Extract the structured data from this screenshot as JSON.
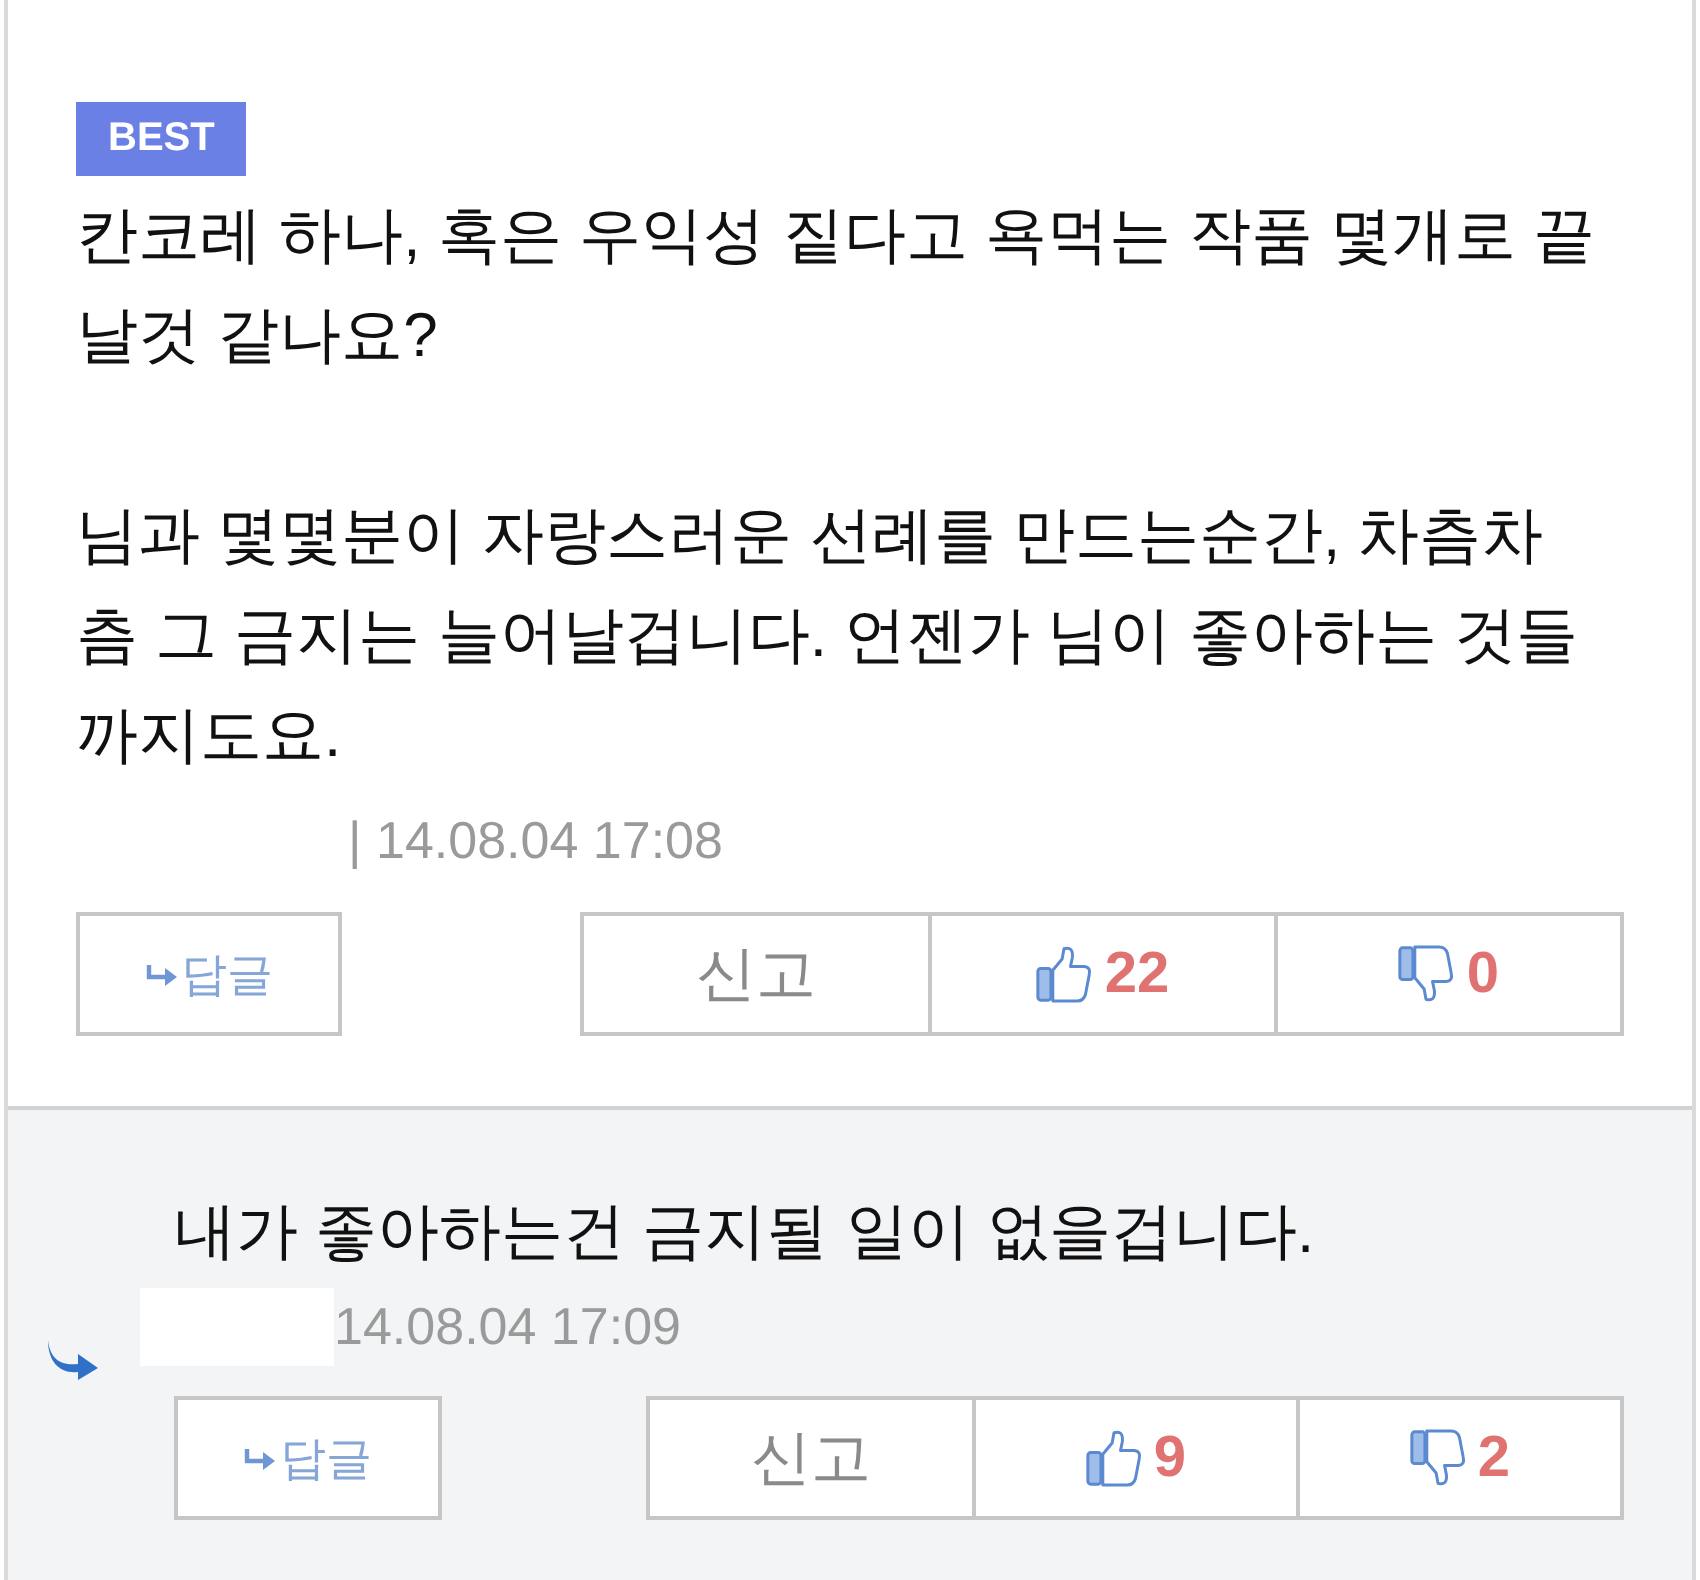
{
  "comments": [
    {
      "kind": "best",
      "badge": "BEST",
      "paragraphs": [
        "칸코레 하나, 혹은 우익성 짙다고 욕먹는 작품 몇개로 끝날것 같나요?",
        "님과 몇몇분이 자랑스러운 선례를 만드는순간, 차츰차츰 그 금지는 늘어날겁니다. 언젠가 님이 좋아하는 것들까지도요."
      ],
      "timestamp": "| 14.08.04 17:08",
      "reply_button": "답글",
      "report_button": "신고",
      "likes": "22",
      "dislikes": "0"
    },
    {
      "kind": "reply",
      "paragraphs": [
        "내가 좋아하는건 금지될 일이 없을겁니다."
      ],
      "name_hidden": true,
      "timestamp": "14.08.04 17:09",
      "reply_button": "답글",
      "report_button": "신고",
      "likes": "9",
      "dislikes": "2"
    }
  ]
}
